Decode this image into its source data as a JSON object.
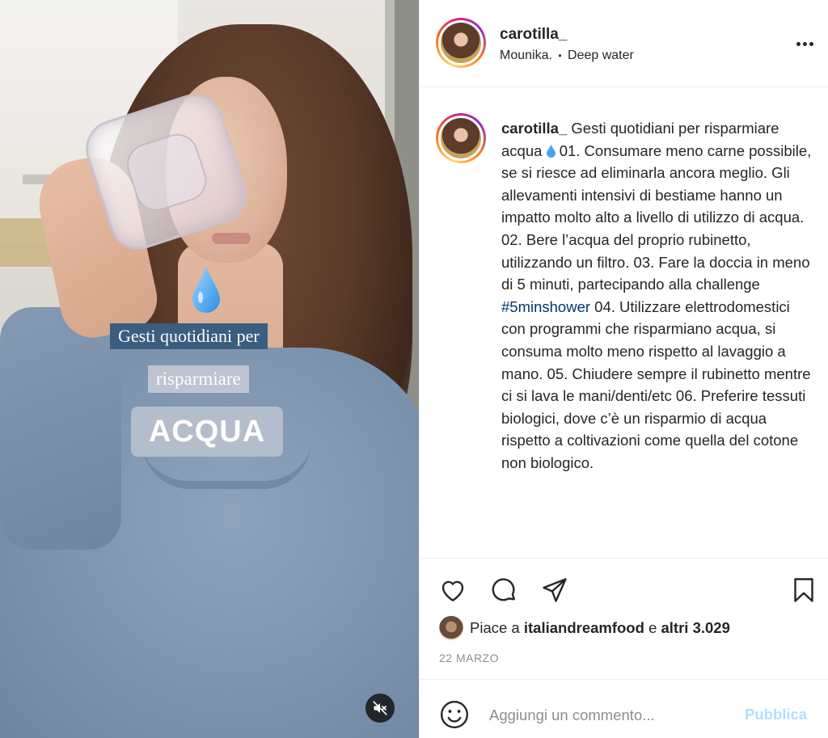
{
  "post": {
    "username": "carotilla_",
    "audio_artist": "Mounika.",
    "separator": "•",
    "audio_track": "Deep water",
    "caption_username": "carotilla_",
    "caption_part1": "Gesti quotidiani per risparmiare acqua",
    "caption_part2": "01. Consumare meno carne possibile, se si riesce ad eliminarla ancora meglio. Gli allevamenti intensivi di bestiame hanno un impatto molto alto a livello di utilizzo di acqua. 02. Bere l’acqua del proprio rubinetto, utilizzando un filtro. 03. Fare la doccia in meno di 5 minuti, partecipando alla challenge",
    "hashtag": "#5minshower",
    "caption_part3": "04. Utilizzare elettrodomestici con programmi che risparmiano acqua, si consuma molto meno rispetto al lavaggio a mano. 05. Chiudere sempre il rubinetto mentre ci si lava le mani/denti/etc 06. Preferire tessuti biologici, dove c’è un risparmio di acqua rispetto a coltivazioni come quella del cotone non biologico.",
    "likes_prefix": "Piace a",
    "likes_user": "italiandreamfood",
    "likes_conj": "e",
    "likes_others": "altri 3.029",
    "date": "22 MARZO"
  },
  "media": {
    "overlay_line1": "Gesti quotidiani per",
    "overlay_line2": "risparmiare",
    "overlay_line3": "ACQUA"
  },
  "comment_box": {
    "placeholder": "Aggiungi un commento...",
    "publish_label": "Pubblica"
  },
  "colors": {
    "accent_disabled": "#b2dffc",
    "hashtag": "#00376b",
    "text": "#262626",
    "muted": "#8e8e8e"
  },
  "icons": {
    "like": "heart-icon",
    "comment": "comment-icon",
    "share": "paper-plane-icon",
    "save": "bookmark-icon",
    "more": "more-horizontal-icon",
    "mute": "speaker-muted-icon",
    "emoji": "smiley-icon"
  }
}
